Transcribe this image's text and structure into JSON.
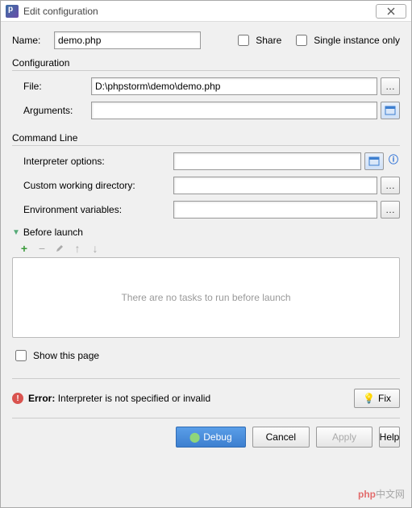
{
  "titlebar": {
    "title": "Edit configuration"
  },
  "name": {
    "label": "Name:",
    "value": "demo.php"
  },
  "share": {
    "label": "Share",
    "checked": false
  },
  "single_instance": {
    "label": "Single instance only",
    "checked": false
  },
  "configuration": {
    "section_title": "Configuration",
    "file": {
      "label": "File:",
      "value": "D:\\phpstorm\\demo\\demo.php"
    },
    "arguments": {
      "label": "Arguments:",
      "value": ""
    }
  },
  "command_line": {
    "section_title": "Command Line",
    "interpreter_options": {
      "label": "Interpreter options:",
      "value": ""
    },
    "working_dir": {
      "label": "Custom working directory:",
      "value": ""
    },
    "env_vars": {
      "label": "Environment variables:",
      "value": ""
    }
  },
  "before_launch": {
    "title": "Before launch",
    "empty_text": "There are no tasks to run before launch",
    "show_this_page": {
      "label": "Show this page",
      "checked": false
    }
  },
  "error": {
    "prefix": "Error:",
    "message": "Interpreter is not specified or invalid",
    "fix_label": "Fix"
  },
  "buttons": {
    "debug": "Debug",
    "cancel": "Cancel",
    "apply": "Apply",
    "help": "Help"
  },
  "watermark": {
    "brand": "php",
    "suffix": "中文网"
  }
}
